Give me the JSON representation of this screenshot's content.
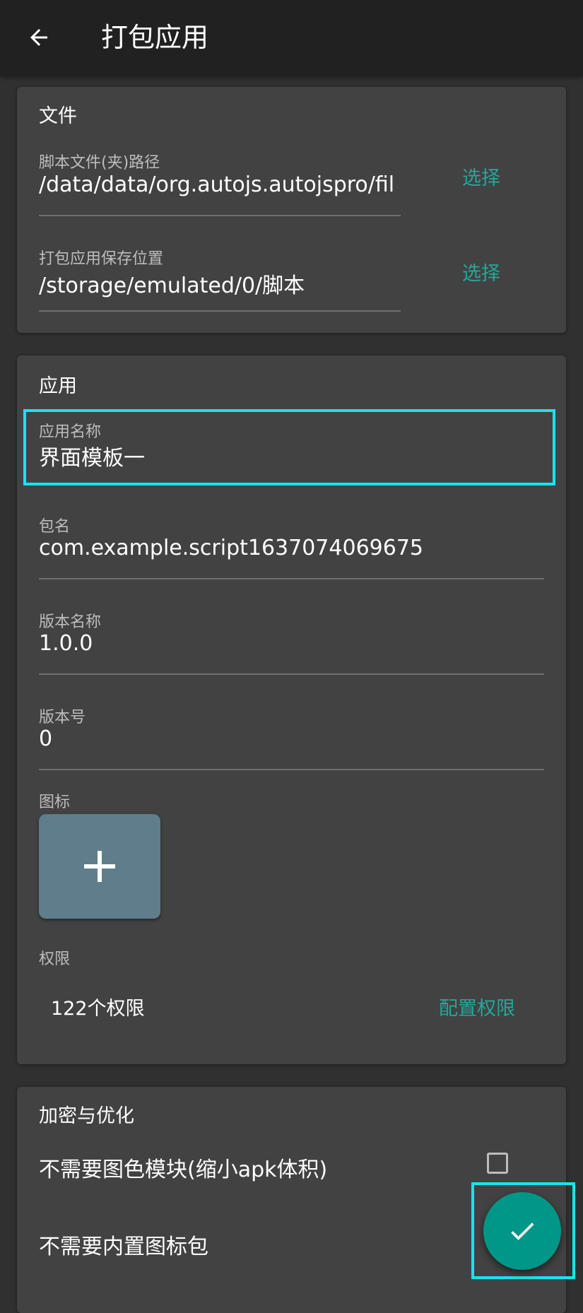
{
  "appbar": {
    "title": "打包应用",
    "back_icon": "arrow-back-icon"
  },
  "file_section": {
    "title": "文件",
    "script_path": {
      "label": "脚本文件(夹)路径",
      "value": "/data/data/org.autojs.autojspro/fil",
      "action": "选择"
    },
    "save_path": {
      "label": "打包应用保存位置",
      "value": "/storage/emulated/0/脚本",
      "action": "选择"
    }
  },
  "app_section": {
    "title": "应用",
    "app_name": {
      "label": "应用名称",
      "value": "界面模板一"
    },
    "package_name": {
      "label": "包名",
      "value": "com.example.script1637074069675"
    },
    "version_name": {
      "label": "版本名称",
      "value": "1.0.0"
    },
    "version_code": {
      "label": "版本号",
      "value": "0"
    },
    "icon": {
      "label": "图标",
      "add_icon": "plus-icon"
    },
    "permissions": {
      "label": "权限",
      "summary": "122个权限",
      "action": "配置权限"
    }
  },
  "encrypt_section": {
    "title": "加密与优化",
    "options": [
      {
        "label": "不需要图色模块(缩小apk体积)",
        "checked": false
      },
      {
        "label": "不需要内置图标包"
      }
    ]
  },
  "fab": {
    "icon": "check-icon"
  },
  "colors": {
    "background": "#303030",
    "appbar": "#212121",
    "card": "#424242",
    "accent": "#26a69a",
    "fab": "#009688",
    "icon_tile": "#607d8b",
    "highlight": "#17e4ef"
  }
}
